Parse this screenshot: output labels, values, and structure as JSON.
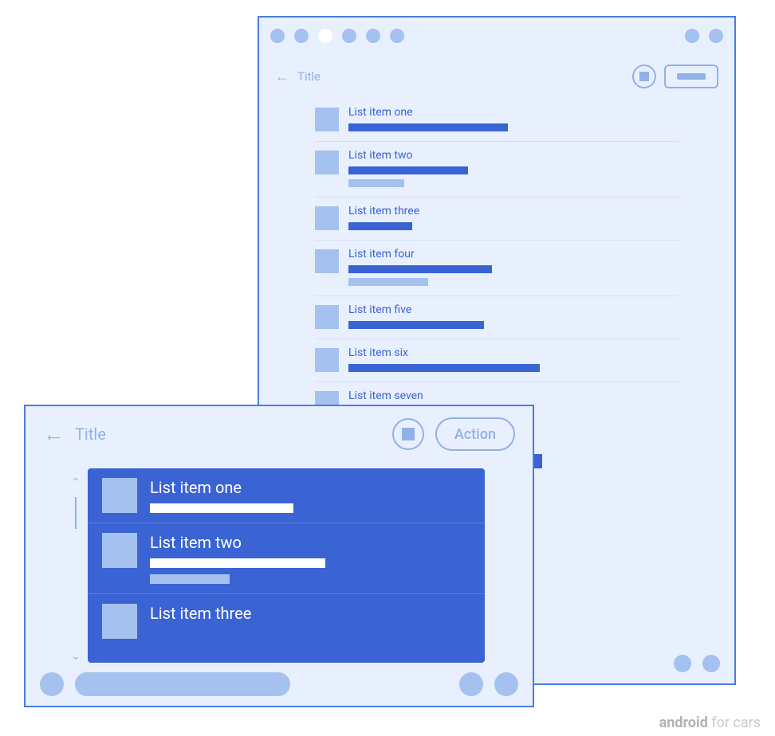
{
  "colors": {
    "panel_bg": "#e9f0fd",
    "accent": "#3a63d4",
    "accent_light": "#a4c1ef",
    "outline": "#90b1e8",
    "frame": "#4a7ce0"
  },
  "back_window": {
    "header": {
      "title": "Title"
    },
    "action_button_label": "",
    "list": [
      {
        "title": "List item one",
        "bar1_w": 200,
        "bar2_w": 0
      },
      {
        "title": "List item two",
        "bar1_w": 150,
        "bar2_w": 70
      },
      {
        "title": "List item three",
        "bar1_w": 80,
        "bar2_w": 0
      },
      {
        "title": "List item four",
        "bar1_w": 180,
        "bar2_w": 100
      },
      {
        "title": "List item five",
        "bar1_w": 170,
        "bar2_w": 0
      },
      {
        "title": "List item six",
        "bar1_w": 240,
        "bar2_w": 0
      },
      {
        "title": "List item seven",
        "bar1_w": 110,
        "bar2_w": 0
      }
    ]
  },
  "front_window": {
    "header": {
      "title": "Title",
      "action_label": "Action"
    },
    "list": [
      {
        "title": "List item one",
        "has_bar2": false
      },
      {
        "title": "List item two",
        "has_bar2": true
      },
      {
        "title": "List item three",
        "has_bar2": false
      }
    ]
  },
  "watermark": {
    "brand": "android",
    "suffix": " for cars"
  }
}
